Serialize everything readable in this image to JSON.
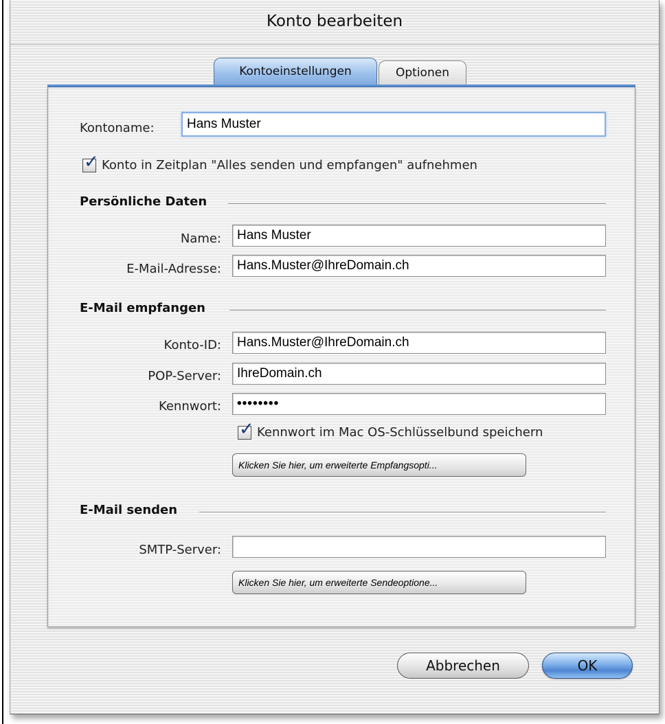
{
  "window": {
    "title": "Konto bearbeiten"
  },
  "tabs": [
    {
      "label": "Kontoeinstellungen",
      "active": true
    },
    {
      "label": "Optionen",
      "active": false
    }
  ],
  "account": {
    "name_label": "Kontoname:",
    "name_value": "Hans Muster",
    "schedule_checkbox_label": "Konto in Zeitplan \"Alles senden und empfangen\" aufnehmen",
    "schedule_checked": true
  },
  "personal": {
    "section_title": "Persönliche Daten",
    "name_label": "Name:",
    "name_value": "Hans Muster",
    "email_label": "E-Mail-Adresse:",
    "email_value": "Hans.Muster@IhreDomain.ch"
  },
  "receive": {
    "section_title": "E-Mail empfangen",
    "account_id_label": "Konto-ID:",
    "account_id_value": "Hans.Muster@IhreDomain.ch",
    "pop_label": "POP-Server:",
    "pop_value": "IhreDomain.ch",
    "password_label": "Kennwort:",
    "password_value": "••••••••",
    "keychain_label": "Kennwort im Mac OS-Schlüsselbund speichern",
    "keychain_checked": true,
    "advanced_button": "Klicken Sie hier, um erweiterte Empfangsopti..."
  },
  "send": {
    "section_title": "E-Mail senden",
    "smtp_label": "SMTP-Server:",
    "smtp_value": "",
    "advanced_button": "Klicken Sie hier, um erweiterte Sendeoptione..."
  },
  "buttons": {
    "cancel": "Abbrechen",
    "ok": "OK"
  },
  "colors": {
    "accent_blue": "#6fa0dc",
    "ok_button": "#4f86d2",
    "focus_ring": "#86aee4"
  }
}
